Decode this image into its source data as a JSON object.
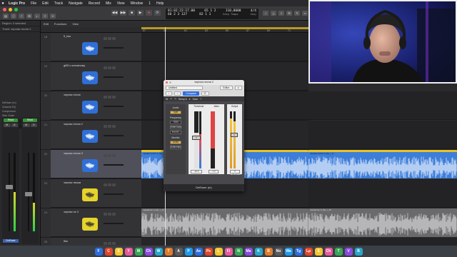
{
  "menubar": {
    "app": "Logic Pro",
    "items": [
      "File",
      "Edit",
      "Track",
      "Navigate",
      "Record",
      "Mix",
      "View",
      "Window",
      "1",
      "Help"
    ]
  },
  "window": {
    "title": "zaspotliona mix.logicx - zaspotliona mix - Tracks"
  },
  "lcd": {
    "time": "01:02:22:17.00",
    "bars": "66  2  3  127",
    "pos1": "65  1  2",
    "pos2": "82  1  1",
    "tempo": "110,0000",
    "keep_tempo": "Keep Tempo",
    "sig": "4/4",
    "key": "Cmaj"
  },
  "inspector": {
    "region_label": "Region: 3 selected",
    "track_label": "Track: черная песня 2",
    "plugins": [
      "DeEsser (m)",
      "Channel EQ",
      "Compressor",
      "Side Chain",
      "DeEsser"
    ],
    "read": "Read",
    "channel_name": "DeEsser"
  },
  "tracks_toolbar": {
    "edit": "Edit",
    "functions": "Functions",
    "view": "View"
  },
  "ruler": {
    "ticks": [
      "57",
      "59",
      "61",
      "63",
      "65",
      "67",
      "69",
      "71"
    ]
  },
  "tracks": [
    {
      "num": "18",
      "name": "5_bss",
      "color": "#2f6fd6"
    },
    {
      "num": "19",
      "name": "gt05 к основному",
      "color": "#2f6fd6"
    },
    {
      "num": "20",
      "name": "черная песня",
      "color": "#2f6fd6"
    },
    {
      "num": "21",
      "name": "черная песня 2",
      "color": "#2f6fd6"
    },
    {
      "num": "22",
      "name": "черная песня 3",
      "color": "#2f6fd6"
    },
    {
      "num": "23",
      "name": "черная твоим",
      "color": "#e6d32b"
    },
    {
      "num": "24",
      "name": "черная не 3",
      "color": "#e6d32b"
    },
    {
      "num": "25",
      "name": "бас",
      "color": "#2f6fd6"
    }
  ],
  "regions": {
    "lane4": [
      "черная песня 2_bip_r_5",
      "черная песня 2_bip_r_9",
      "черная песня 2_bip_r_7"
    ],
    "lane7": [
      "черная ве 3_bip_r_14",
      "черная ве 3_bip_r_12",
      "черная 3_bip_22",
      "черная 3_bip_23",
      "черная ве 3_bip_r_18"
    ]
  },
  "plugin": {
    "title": "черная песня 2",
    "preset": "Untitled",
    "compare": "Compare",
    "editor": "Editor",
    "waves_preset": "A: Default Preset",
    "setup": "Setup A",
    "save": "Save",
    "help": "?",
    "audio_label": "Audio",
    "split": "Split",
    "frequency_label": "Frequency",
    "freq_value": "7000",
    "sidechain": "SideChain",
    "ext_sc": "Ext SC",
    "monitor_label": "Monitor",
    "audio_btn": "Audio",
    "sidechain_btn": "Sidechain",
    "threshold_label": "Threshold",
    "atten_label": "Atten",
    "output_label": "Output",
    "threshold_value": "-24.0",
    "atten_value": "-1.0",
    "output_value": "0",
    "brand": "DeEsser",
    "footer": "DeEsser (m)"
  },
  "dock": [
    "F",
    "C",
    "S",
    "Y",
    "M",
    "Ch",
    "W",
    "T",
    "A",
    "P",
    "Ae",
    "Ps",
    "L",
    "Fi",
    "N",
    "Ma",
    "K",
    "B",
    "No",
    "Wa",
    "Tg",
    "Lp",
    "S",
    "Ch",
    "T",
    "V",
    "B"
  ],
  "colors": {
    "blue_track": "#2f6fd6",
    "yellow_track": "#e6d32b",
    "region_blue": "#3d7ed8",
    "region_yellow_bar": "#e7c22a",
    "region_gray": "#6a6a6d"
  }
}
